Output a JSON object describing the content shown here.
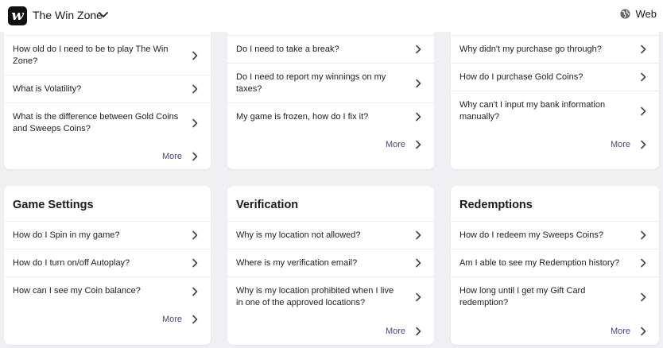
{
  "header": {
    "logo_glyph": "w",
    "brand": "The Win Zone",
    "web_label": "Web"
  },
  "more_label": "More",
  "cards_top": [
    {
      "items": [
        "How old do I need to be to play The Win Zone?",
        "What is Volatility?",
        "What is the difference between Gold Coins and Sweeps Coins?"
      ]
    },
    {
      "items": [
        "Do I need to take a break?",
        "Do I need to report my winnings on my taxes?",
        "My game is frozen, how do I fix it?"
      ]
    },
    {
      "items": [
        "Why didn't my purchase go through?",
        "How do I purchase Gold Coins?",
        "Why can't I input my bank information manually?"
      ]
    }
  ],
  "cards_bottom": [
    {
      "title": "Game Settings",
      "items": [
        "How do I Spin in my game?",
        "How do I turn on/off Autoplay?",
        "How can I see my Coin balance?"
      ]
    },
    {
      "title": "Verification",
      "items": [
        "Why is my location not allowed?",
        "Where is my verification email?",
        "Why is my location prohibited when I live in one of the approved locations?"
      ]
    },
    {
      "title": "Redemptions",
      "items": [
        "How do I redeem my Sweeps Coins?",
        "Am I able to see my Redemption history?",
        "How long until I get my Gift Card redemption?"
      ]
    }
  ]
}
